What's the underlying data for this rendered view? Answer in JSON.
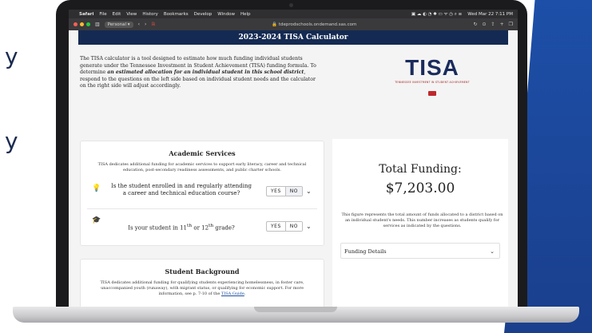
{
  "side_letters": [
    "y",
    "y"
  ],
  "menubar": {
    "apple": "",
    "items": [
      "Safari",
      "File",
      "Edit",
      "View",
      "History",
      "Bookmarks",
      "Develop",
      "Window",
      "Help"
    ],
    "clock": "Wed Mar 22 7:11 PM"
  },
  "toolbar": {
    "profile": "Personal",
    "url": "tdeprodschools.ondemand.sas.com"
  },
  "page": {
    "title": "2023-2024 TISA Calculator",
    "intro_part1": "The TISA calculator is a tool designed to estimate how much funding individual students generate under the Tennessee Investment in Student Achievement (TISA) funding formula. To determine ",
    "intro_bold": "an estimated allocation for an individual student in this school district",
    "intro_part2": ", respond to the questions on the left side based on individual student needs and the calculator on the right side will adjust accordingly.",
    "logo": {
      "word": "TISA",
      "tagline": "TENNESSEE INVESTMENT IN STUDENT ACHIEVEMENT"
    },
    "academic": {
      "heading": "Academic Services",
      "description": "TISA dedicates additional funding for academic services to support early literacy, career and technical education, post-secondary readiness assessments, and public charter schools.",
      "q1": "Is the student enrolled in and regularly attending a career and technical education course?",
      "q2_pre": "Is your student in 11",
      "q2_sup1": "th",
      "q2_mid": " or 12",
      "q2_sup2": "th",
      "q2_post": " grade?",
      "yes": "YES",
      "no": "NO"
    },
    "background": {
      "heading": "Student Background",
      "description": "TISA dedicates additional funding for qualifying students experiencing homelessness, in foster care, unaccompanied youth (runaway), with migrant status, or qualifying for economic support. For more information, see p. 7-10 of the ",
      "link": "TISA Guide",
      "after_link": "."
    },
    "funding": {
      "label": "Total Funding:",
      "value": "$7,203.00",
      "explanation": "This figure represents the total amount of funds allocated to a district based on an individual student's needs. This number increases as students qualify for services as indicated by the questions.",
      "details": "Funding Details"
    }
  }
}
